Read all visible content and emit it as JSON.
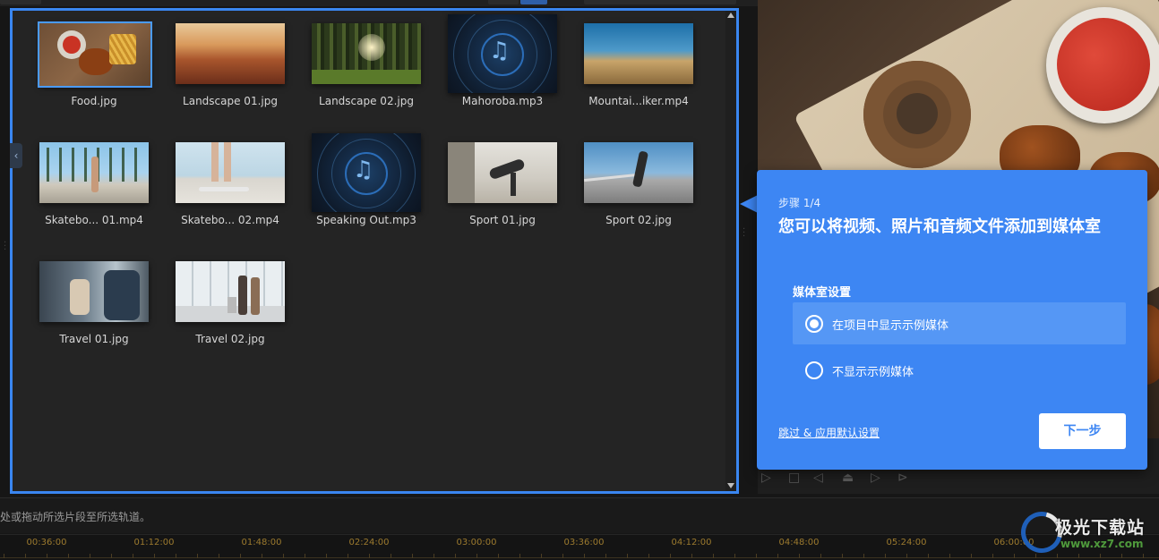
{
  "library": {
    "items": [
      {
        "name": "Food.jpg",
        "kind": "image"
      },
      {
        "name": "Landscape 01.jpg",
        "kind": "image"
      },
      {
        "name": "Landscape 02.jpg",
        "kind": "image"
      },
      {
        "name": "Mahoroba.mp3",
        "kind": "audio"
      },
      {
        "name": "Mountai...iker.mp4",
        "kind": "video"
      },
      {
        "name": "Skatebo... 01.mp4",
        "kind": "video"
      },
      {
        "name": "Skatebo... 02.mp4",
        "kind": "video"
      },
      {
        "name": "Speaking Out.mp3",
        "kind": "audio"
      },
      {
        "name": "Sport 01.jpg",
        "kind": "image"
      },
      {
        "name": "Sport 02.jpg",
        "kind": "image"
      },
      {
        "name": "Travel 01.jpg",
        "kind": "image"
      },
      {
        "name": "Travel 02.jpg",
        "kind": "image"
      }
    ],
    "selected_index": 0,
    "collapse_icon": "chevron-left-icon"
  },
  "tour": {
    "step": "步骤 1/4",
    "title": "您可以将视频、照片和音频文件添加到媒体室",
    "settings_label": "媒体室设置",
    "options": [
      {
        "label": "在项目中显示示例媒体",
        "checked": true
      },
      {
        "label": "不显示示例媒体",
        "checked": false
      }
    ],
    "skip_link": "跳过 & 应用默认设置",
    "next_button": "下一步",
    "accent": "#3d86f3"
  },
  "hint": "处或拖动所选片段至所选轨道。",
  "timeline": {
    "ticks": [
      "00:36:00",
      "01:12:00",
      "01:48:00",
      "02:24:00",
      "03:00:00",
      "03:36:00",
      "04:12:00",
      "04:48:00",
      "05:24:00",
      "06:00:00"
    ]
  },
  "watermark": {
    "text": "极光下载站",
    "url": "www.xz7.com"
  }
}
